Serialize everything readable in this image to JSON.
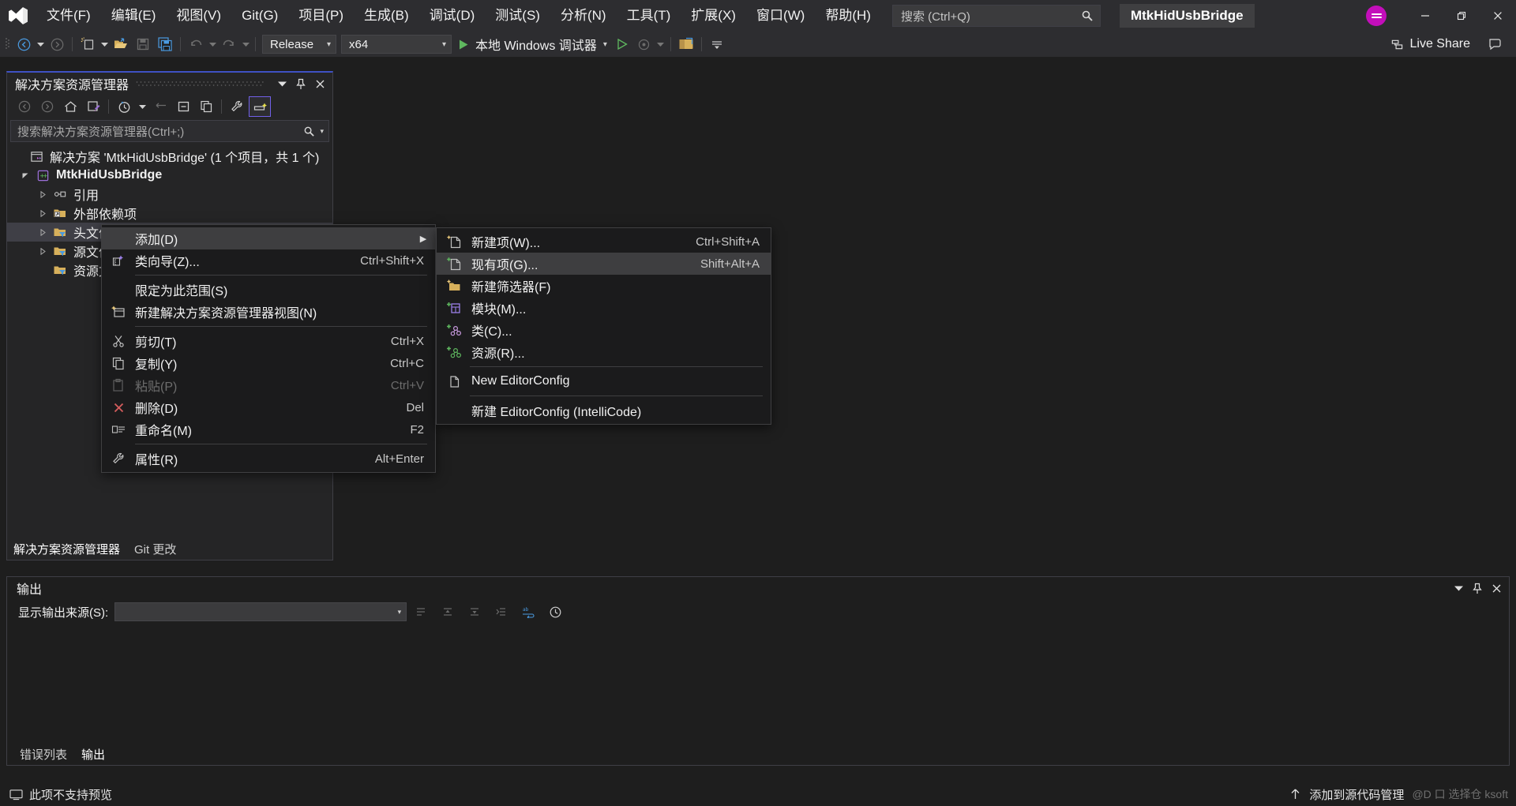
{
  "titlebar": {
    "logo_icon": "visual-studio-logo",
    "menus": [
      {
        "label": "文件(F)"
      },
      {
        "label": "编辑(E)"
      },
      {
        "label": "视图(V)"
      },
      {
        "label": "Git(G)"
      },
      {
        "label": "项目(P)"
      },
      {
        "label": "生成(B)"
      },
      {
        "label": "调试(D)"
      },
      {
        "label": "测试(S)"
      },
      {
        "label": "分析(N)"
      },
      {
        "label": "工具(T)"
      },
      {
        "label": "扩展(X)"
      },
      {
        "label": "窗口(W)"
      },
      {
        "label": "帮助(H)"
      }
    ],
    "search_placeholder": "搜索 (Ctrl+Q)",
    "search_icon": "search-icon",
    "project_chip": "MtkHidUsbBridge",
    "avatar_icon": "user-avatar",
    "minimize_icon": "minimize-icon",
    "restore_icon": "restore-icon",
    "close_icon": "close-icon",
    "avatar_color": "#c30eba"
  },
  "toolbar": {
    "nav_back_icon": "navigate-back-icon",
    "nav_forward_icon": "navigate-forward-icon",
    "new_project_icon": "new-project-icon",
    "open_file_icon": "open-file-icon",
    "save_icon": "save-icon",
    "save_all_icon": "save-all-icon",
    "undo_icon": "undo-icon",
    "redo_icon": "redo-icon",
    "config_value": "Release",
    "platform_value": "x64",
    "debug_play_icon": "start-debug-icon",
    "debug_target": "本地 Windows 调试器",
    "debug_dropdown_icon": "chevron-down-icon",
    "run_no_debug_icon": "start-without-debugging-icon",
    "select_startup_icon": "select-startup-item-icon",
    "layout_icon": "window-layout-icon",
    "overflow_icon": "toolbar-overflow-icon",
    "live_share_label": "Live Share",
    "live_share_icon": "live-share-icon",
    "feedback_icon": "send-feedback-icon"
  },
  "solution_explorer": {
    "title": "解决方案资源管理器",
    "dropdown_icon": "chevron-down-icon",
    "pin_icon": "pin-icon",
    "close_icon": "close-icon",
    "toolbar": {
      "back_icon": "back-icon",
      "forward_icon": "forward-icon",
      "home_icon": "home-icon",
      "pending_changes_icon": "pending-changes-filter-icon",
      "history_icon": "history-icon",
      "history_caret_icon": "chevron-down-icon",
      "sync_icon": "sync-with-active-document-icon",
      "collapse_icon": "collapse-all-icon",
      "properties_window_icon": "show-all-files-icon",
      "wrench_icon": "properties-icon",
      "preview_icon": "preview-selected-items-icon"
    },
    "search_placeholder": "搜索解决方案资源管理器(Ctrl+;)",
    "search_icon": "search-icon",
    "search_caret_icon": "chevron-down-icon",
    "tree": [
      {
        "label": "解决方案 'MtkHidUsbBridge' (1 个项目，共 1 个)",
        "icon": "solution-icon",
        "indent": 0,
        "twisty": "none",
        "bold": false,
        "selected": false
      },
      {
        "label": "MtkHidUsbBridge",
        "icon": "cpp-project-icon",
        "indent": 1,
        "twisty": "expanded",
        "bold": true,
        "selected": false
      },
      {
        "label": "引用",
        "icon": "references-icon",
        "indent": 2,
        "twisty": "collapsed",
        "bold": false,
        "selected": false
      },
      {
        "label": "外部依赖项",
        "icon": "external-dependencies-icon",
        "indent": 2,
        "twisty": "collapsed",
        "bold": false,
        "selected": false
      },
      {
        "label": "头文件",
        "icon": "filter-folder-icon",
        "indent": 2,
        "twisty": "collapsed",
        "bold": false,
        "selected": true
      },
      {
        "label": "源文件",
        "icon": "filter-folder-icon",
        "indent": 2,
        "twisty": "collapsed",
        "bold": false,
        "selected": false
      },
      {
        "label": "资源文件",
        "icon": "filter-folder-icon",
        "indent": 2,
        "twisty": "none",
        "bold": false,
        "selected": false
      }
    ],
    "tabs": [
      {
        "label": "解决方案资源管理器",
        "active": true
      },
      {
        "label": "Git 更改",
        "active": false
      }
    ]
  },
  "context_menu": {
    "items": [
      {
        "label": "添加(D)",
        "shortcut": "",
        "icon": "",
        "submenu": true,
        "highlighted": true,
        "disabled": false
      },
      {
        "label": "类向导(Z)...",
        "shortcut": "Ctrl+Shift+X",
        "icon": "class-wizard-icon",
        "submenu": false,
        "highlighted": false,
        "disabled": false
      },
      {
        "separator": true
      },
      {
        "label": "限定为此范围(S)",
        "shortcut": "",
        "icon": "",
        "submenu": false,
        "highlighted": false,
        "disabled": false
      },
      {
        "label": "新建解决方案资源管理器视图(N)",
        "shortcut": "",
        "icon": "new-solution-explorer-view-icon",
        "submenu": false,
        "highlighted": false,
        "disabled": false
      },
      {
        "separator": true
      },
      {
        "label": "剪切(T)",
        "shortcut": "Ctrl+X",
        "icon": "cut-icon",
        "submenu": false,
        "highlighted": false,
        "disabled": false
      },
      {
        "label": "复制(Y)",
        "shortcut": "Ctrl+C",
        "icon": "copy-icon",
        "submenu": false,
        "highlighted": false,
        "disabled": false
      },
      {
        "label": "粘贴(P)",
        "shortcut": "Ctrl+V",
        "icon": "paste-icon",
        "submenu": false,
        "highlighted": false,
        "disabled": true
      },
      {
        "label": "删除(D)",
        "shortcut": "Del",
        "icon": "delete-icon",
        "submenu": false,
        "highlighted": false,
        "disabled": false
      },
      {
        "label": "重命名(M)",
        "shortcut": "F2",
        "icon": "rename-icon",
        "submenu": false,
        "highlighted": false,
        "disabled": false
      },
      {
        "separator": true
      },
      {
        "label": "属性(R)",
        "shortcut": "Alt+Enter",
        "icon": "properties-wrench-icon",
        "submenu": false,
        "highlighted": false,
        "disabled": false
      }
    ]
  },
  "submenu": {
    "items": [
      {
        "label": "新建项(W)...",
        "shortcut": "Ctrl+Shift+A",
        "icon": "new-item-icon",
        "highlighted": false
      },
      {
        "label": "现有项(G)...",
        "shortcut": "Shift+Alt+A",
        "icon": "existing-item-icon",
        "highlighted": true
      },
      {
        "label": "新建筛选器(F)",
        "shortcut": "",
        "icon": "new-filter-icon",
        "highlighted": false
      },
      {
        "label": "模块(M)...",
        "shortcut": "",
        "icon": "module-icon",
        "highlighted": false
      },
      {
        "label": "类(C)...",
        "shortcut": "",
        "icon": "class-icon",
        "highlighted": false
      },
      {
        "label": "资源(R)...",
        "shortcut": "",
        "icon": "resource-icon",
        "highlighted": false
      },
      {
        "separator": true
      },
      {
        "label": "New EditorConfig",
        "shortcut": "",
        "icon": "editorconfig-icon",
        "highlighted": false
      },
      {
        "separator": true
      },
      {
        "label": "新建 EditorConfig (IntelliCode)",
        "shortcut": "",
        "icon": "",
        "highlighted": false
      }
    ]
  },
  "output_panel": {
    "title": "输出",
    "dropdown_icon": "chevron-down-icon",
    "pin_icon": "pin-icon",
    "close_icon": "close-icon",
    "source_label": "显示输出来源(S):",
    "source_value": "",
    "source_caret_icon": "chevron-down-icon",
    "toolbar_icons": [
      "find-message-icon",
      "go-to-previous-message-icon",
      "go-to-next-message-icon",
      "clear-all-icon",
      "toggle-word-wrap-icon",
      "show-timestamps-icon"
    ],
    "tabs": [
      {
        "label": "错误列表",
        "active": false
      },
      {
        "label": "输出",
        "active": true
      }
    ]
  },
  "statusbar": {
    "icon": "preview-unavailable-icon",
    "message": "此项不支持预览",
    "right_icon": "source-control-up-arrow-icon",
    "right_message": "添加到源代码管理",
    "watermark": "@D 口 选择仓 ksoft"
  }
}
